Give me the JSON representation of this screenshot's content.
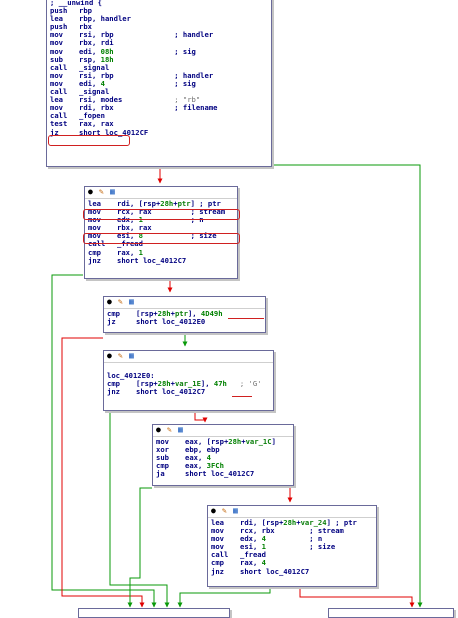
{
  "colors": {
    "edge_true": "#0a9a0a",
    "edge_false": "#e00000",
    "highlight": "#d02020",
    "text": "#000080",
    "number": "#008000"
  },
  "icons": [
    "graph-node-color-icon",
    "graph-node-rename-icon",
    "graph-node-group-icon"
  ],
  "block1": {
    "lines": [
      {
        "t": "; __unwind {"
      },
      {
        "m": "push",
        "a": "rbp"
      },
      {
        "m": "lea",
        "a": "rbp, handler"
      },
      {
        "m": "push",
        "a": "rbx"
      },
      {
        "m": "mov",
        "a": "rsi, rbp",
        "c": "; handler"
      },
      {
        "m": "mov",
        "a": "rbx, rdi"
      },
      {
        "m": "mov",
        "a": "edi, 08h",
        "c": "; sig"
      },
      {
        "m": "sub",
        "a": "rsp, 18h"
      },
      {
        "m": "call",
        "a": "_signal"
      },
      {
        "m": "mov",
        "a": "rsi, rbp",
        "c": "; handler"
      },
      {
        "m": "mov",
        "a": "edi, 4",
        "c": "; sig"
      },
      {
        "m": "call",
        "a": "_signal"
      },
      {
        "m": "lea",
        "a": "rsi, modes",
        "c": "; \"rb\""
      },
      {
        "m": "mov",
        "a": "rdi, rbx",
        "c": "; filename"
      },
      {
        "m": "call",
        "a": "_fopen"
      },
      {
        "m": "test",
        "a": "rax, rax"
      },
      {
        "m": "jz",
        "a": "short loc_4012CF"
      }
    ]
  },
  "block2": {
    "lines": [
      {
        "m": "lea",
        "a": "rdi, [rsp+28h+ptr]",
        "c": "; ptr"
      },
      {
        "m": "mov",
        "a": "rcx, rax",
        "c": "; stream"
      },
      {
        "m": "mov",
        "a": "edx, 1",
        "c": "; n"
      },
      {
        "m": "mov",
        "a": "rbx, rax"
      },
      {
        "m": "mov",
        "a": "esi, 8",
        "c": "; size"
      },
      {
        "m": "call",
        "a": "_fread"
      },
      {
        "m": "cmp",
        "a": "rax, 1"
      },
      {
        "m": "jnz",
        "a": "short loc_4012C7"
      }
    ]
  },
  "block3": {
    "lines": [
      {
        "m": "cmp",
        "a": "[rsp+28h+ptr], 4D49h"
      },
      {
        "m": "jz",
        "a": "short loc_4012E0"
      }
    ]
  },
  "block4": {
    "lines": [
      {
        "t": ""
      },
      {
        "t": "loc_4012E0:"
      },
      {
        "m": "cmp",
        "a": "[rsp+28h+var_1E], 47h",
        "c": "; 'G'"
      },
      {
        "m": "jnz",
        "a": "short loc_4012C7"
      }
    ]
  },
  "block5": {
    "lines": [
      {
        "m": "mov",
        "a": "eax, [rsp+28h+var_1C]"
      },
      {
        "m": "xor",
        "a": "ebp, ebp"
      },
      {
        "m": "sub",
        "a": "eax, 4"
      },
      {
        "m": "cmp",
        "a": "eax, 3FCh"
      },
      {
        "m": "ja",
        "a": "short loc_4012C7"
      }
    ]
  },
  "block6": {
    "lines": [
      {
        "m": "lea",
        "a": "rdi, [rsp+28h+var_24]",
        "c": "; ptr"
      },
      {
        "m": "mov",
        "a": "rcx, rbx",
        "c": "; stream"
      },
      {
        "m": "mov",
        "a": "edx, 4",
        "c": "; n"
      },
      {
        "m": "mov",
        "a": "esi, 1",
        "c": "; size"
      },
      {
        "m": "call",
        "a": "_fread"
      },
      {
        "m": "cmp",
        "a": "rax, 4"
      },
      {
        "m": "jnz",
        "a": "short loc_4012C7"
      }
    ]
  }
}
